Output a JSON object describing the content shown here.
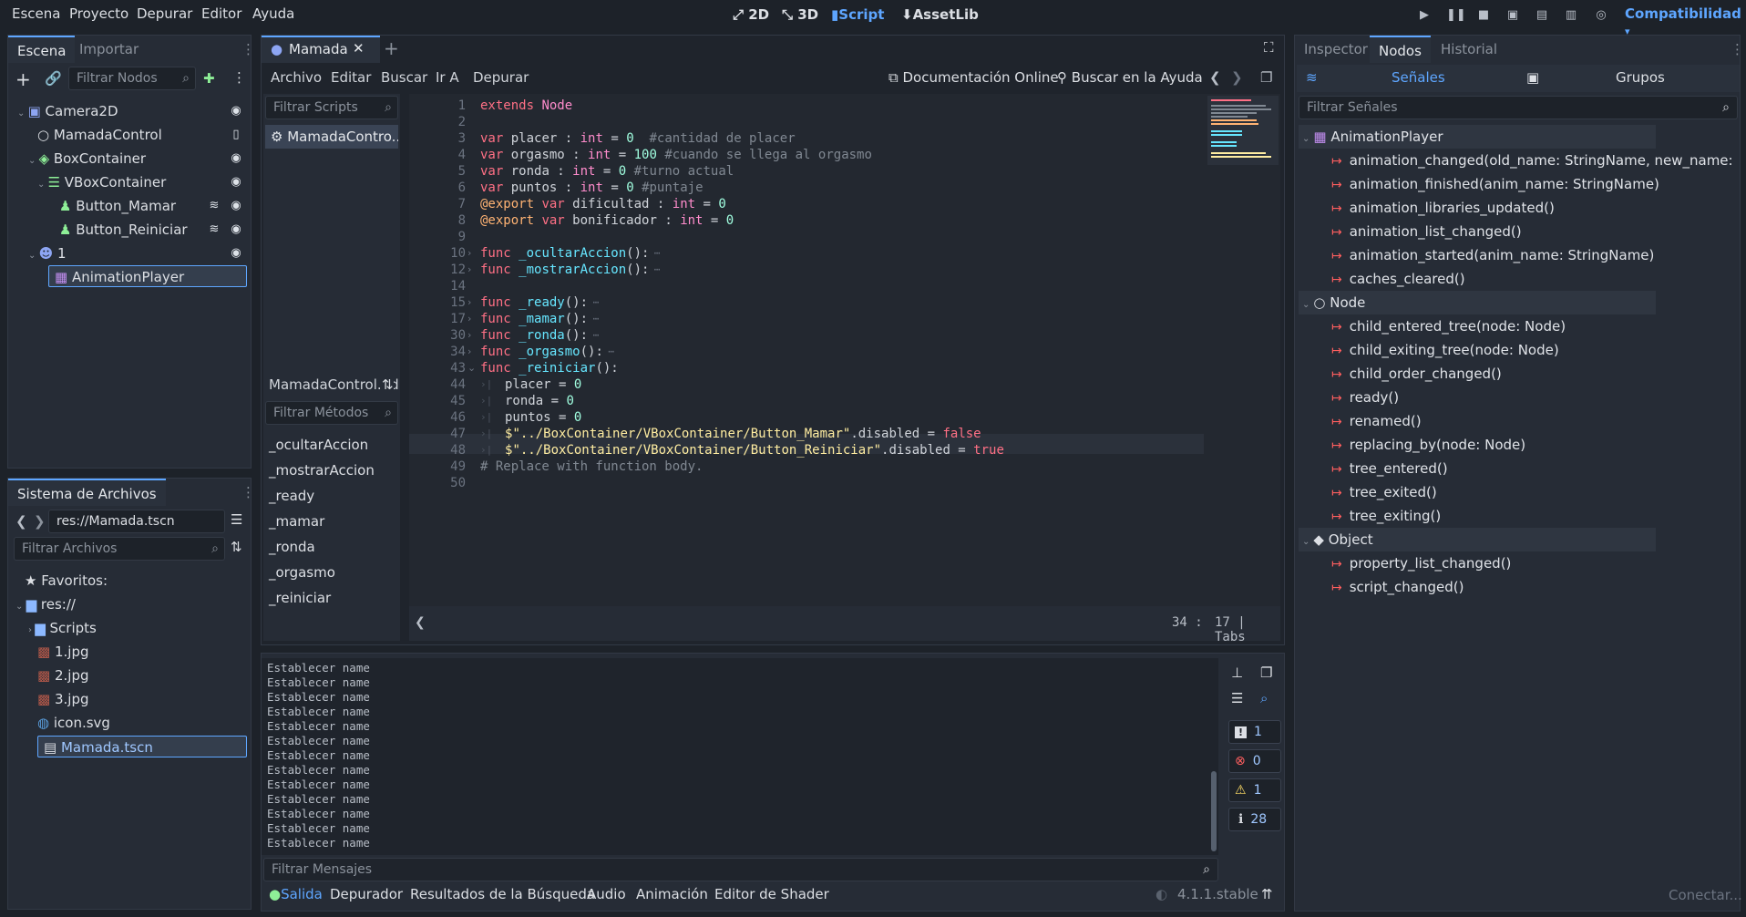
{
  "menu": [
    "Escena",
    "Proyecto",
    "Depurar",
    "Editor",
    "Ayuda"
  ],
  "workspaces": [
    {
      "icon": "2d-icon",
      "label": "2D"
    },
    {
      "icon": "3d-icon",
      "label": "3D"
    },
    {
      "icon": "script-icon",
      "label": "Script"
    },
    {
      "icon": "assetlib-icon",
      "label": "AssetLib"
    }
  ],
  "renderer": "Compatibilidad",
  "scene_dock": {
    "tabs": [
      "Escena",
      "Importar"
    ],
    "filter_placeholder": "Filtrar Nodos",
    "nodes": [
      {
        "name": "Camera2D"
      },
      {
        "name": "MamadaControl"
      },
      {
        "name": "BoxContainer"
      },
      {
        "name": "VBoxContainer"
      },
      {
        "name": "Button_Mamar"
      },
      {
        "name": "Button_Reiniciar"
      },
      {
        "name": "1"
      },
      {
        "name": "AnimationPlayer"
      }
    ]
  },
  "filesystem": {
    "title": "Sistema de Archivos",
    "path": "res://Mamada.tscn",
    "filter_placeholder": "Filtrar Archivos",
    "items": [
      "Favoritos:",
      "res://",
      "Scripts",
      "1.jpg",
      "2.jpg",
      "3.jpg",
      "icon.svg",
      "Mamada.tscn"
    ]
  },
  "script_editor": {
    "tab": "Mamada",
    "menus": [
      "Archivo",
      "Editar",
      "Buscar",
      "Ir A",
      "Depurar"
    ],
    "online_docs": "Documentación Online",
    "search_help": "Buscar en la Ayuda",
    "filter_scripts": "Filtrar Scripts",
    "script_item": "MamadaContro...",
    "current_script": "MamadaControl.gd",
    "filter_methods": "Filtrar Métodos",
    "methods": [
      "_ocultarAccion",
      "_mostrarAccion",
      "_ready",
      "_mamar",
      "_ronda",
      "_orgasmo",
      "_reiniciar"
    ],
    "status": {
      "line": "34",
      "col": "17",
      "indent": "Tabs",
      "sep": ":",
      "bar": "|"
    },
    "code": [
      {
        "n": "1",
        "t": "extends Node"
      },
      {
        "n": "2",
        "t": ""
      },
      {
        "n": "3",
        "t": "var placer : int = 0  #cantidad de placer"
      },
      {
        "n": "4",
        "t": "var orgasmo : int = 100 #cuando se llega al orgasmo"
      },
      {
        "n": "5",
        "t": "var ronda : int = 0 #turno actual"
      },
      {
        "n": "6",
        "t": "var puntos : int = 0 #puntaje"
      },
      {
        "n": "7",
        "t": "@export var dificultad : int = 0"
      },
      {
        "n": "8",
        "t": "@export var bonificador : int = 0"
      },
      {
        "n": "9",
        "t": ""
      },
      {
        "n": "10",
        "t": "func _ocultarAccion():"
      },
      {
        "n": "12",
        "t": "func _mostrarAccion():"
      },
      {
        "n": "14",
        "t": ""
      },
      {
        "n": "15",
        "t": "func _ready():"
      },
      {
        "n": "17",
        "t": "func _mamar():"
      },
      {
        "n": "30",
        "t": "func _ronda():"
      },
      {
        "n": "34",
        "t": "func _orgasmo():"
      },
      {
        "n": "43",
        "t": "func _reiniciar():"
      },
      {
        "n": "44",
        "t": "placer = 0"
      },
      {
        "n": "45",
        "t": "ronda = 0"
      },
      {
        "n": "46",
        "t": "puntos = 0"
      },
      {
        "n": "47",
        "t": "$\"../BoxContainer/VBoxContainer/Button_Mamar\".disabled = false"
      },
      {
        "n": "48",
        "t": "$\"../BoxContainer/VBoxContainer/Button_Reiniciar\".disabled = true"
      },
      {
        "n": "49",
        "t": "# Replace with function body."
      },
      {
        "n": "50",
        "t": ""
      }
    ]
  },
  "output": {
    "lines": [
      "Establecer name",
      "Establecer name",
      "Establecer name",
      "Establecer name",
      "Establecer name",
      "Establecer name",
      "Establecer name",
      "Establecer name",
      "Establecer name",
      "Establecer name",
      "Establecer name",
      "Establecer name",
      "Establecer name"
    ],
    "filter_placeholder": "Filtrar Mensajes",
    "badges": [
      "1",
      "0",
      "1",
      "28"
    ]
  },
  "bottom_tabs": [
    "Salida",
    "Depurador",
    "Resultados de la Búsqueda",
    "Audio",
    "Animación",
    "Editor de Shader"
  ],
  "version": "4.1.1.stable",
  "inspector": {
    "tabs": [
      "Inspector",
      "Nodos",
      "Historial"
    ],
    "subtabs": [
      "Señales",
      "Grupos"
    ],
    "filter_placeholder": "Filtrar Señales",
    "groups": [
      {
        "name": "AnimationPlayer",
        "signals": [
          "animation_changed(old_name: StringName, new_name: StringNam",
          "animation_finished(anim_name: StringName)",
          "animation_libraries_updated()",
          "animation_list_changed()",
          "animation_started(anim_name: StringName)",
          "caches_cleared()"
        ]
      },
      {
        "name": "Node",
        "signals": [
          "child_entered_tree(node: Node)",
          "child_exiting_tree(node: Node)",
          "child_order_changed()",
          "ready()",
          "renamed()",
          "replacing_by(node: Node)",
          "tree_entered()",
          "tree_exited()",
          "tree_exiting()"
        ]
      },
      {
        "name": "Object",
        "signals": [
          "property_list_changed()",
          "script_changed()"
        ]
      }
    ],
    "connect": "Conectar..."
  }
}
